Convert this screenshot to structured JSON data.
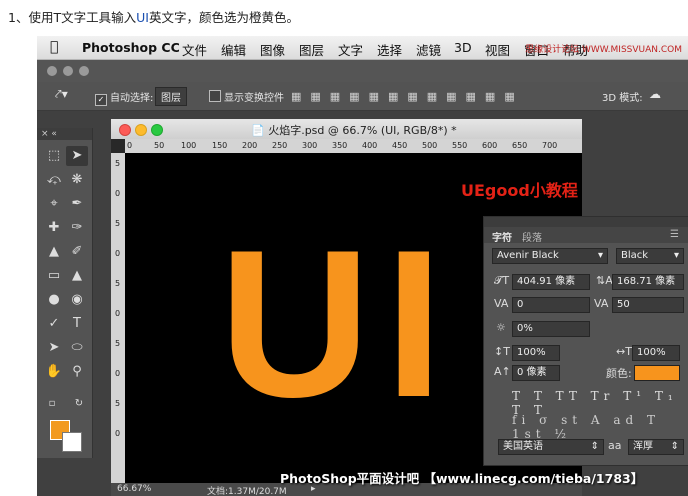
{
  "caption": {
    "prefix": "1、使用T文字工具输入",
    "ui": "UI",
    "suffix": "英文字，颜色选为橙黄色。"
  },
  "menubar": {
    "app": "Photoshop CC",
    "items": [
      "文件",
      "编辑",
      "图像",
      "图层",
      "文字",
      "选择",
      "滤镜",
      "3D",
      "视图",
      "窗口",
      "帮助"
    ],
    "watermark": "思缘设计论坛 WWW.MISSVUAN.COM"
  },
  "options": {
    "auto_select_label": "自动选择:",
    "auto_select_value": "图层",
    "transform_label": "显示变换控件",
    "mode_label": "3D 模式:"
  },
  "document": {
    "title": "火焰字.psd @ 66.7% (UI, RGB/8*) *",
    "ruler_h": [
      "0",
      "50",
      "100",
      "150",
      "200",
      "250",
      "300",
      "350",
      "400",
      "450",
      "500",
      "550",
      "600",
      "650",
      "700"
    ],
    "ruler_v": [
      "5",
      "0",
      "5",
      "0",
      "5",
      "0",
      "5",
      "0",
      "5",
      "0"
    ],
    "canvas_text": "UI",
    "brand": "UEgood小教程",
    "zoom": "66.67%",
    "doc_info": "文档:1.37M/20.7M"
  },
  "footer": "PhotoShop平面设计吧 【www.linecg.com/tieba/1783】",
  "character_panel": {
    "tab_character": "字符",
    "tab_paragraph": "段落",
    "font_family": "Avenir Black",
    "font_style": "Black",
    "font_size": "404.91 像素",
    "leading": "168.71 像素",
    "kerning": "0",
    "tracking": "50",
    "tsume": "0%",
    "vertical_scale": "100%",
    "horizontal_scale": "100%",
    "baseline_shift": "0 像素",
    "color_label": "颜色:",
    "color_value": "#f7941d",
    "styles_row1": "T T TT Tr T¹ T₁ T T",
    "styles_row2": "fi σ st A ad T 1st ½",
    "language": "美国英语",
    "aa_label": "aa",
    "antialias": "浑厚"
  },
  "colors": {
    "foreground": "#f29a1f",
    "background": "#ffffff",
    "text_orange": "#f7941d"
  }
}
